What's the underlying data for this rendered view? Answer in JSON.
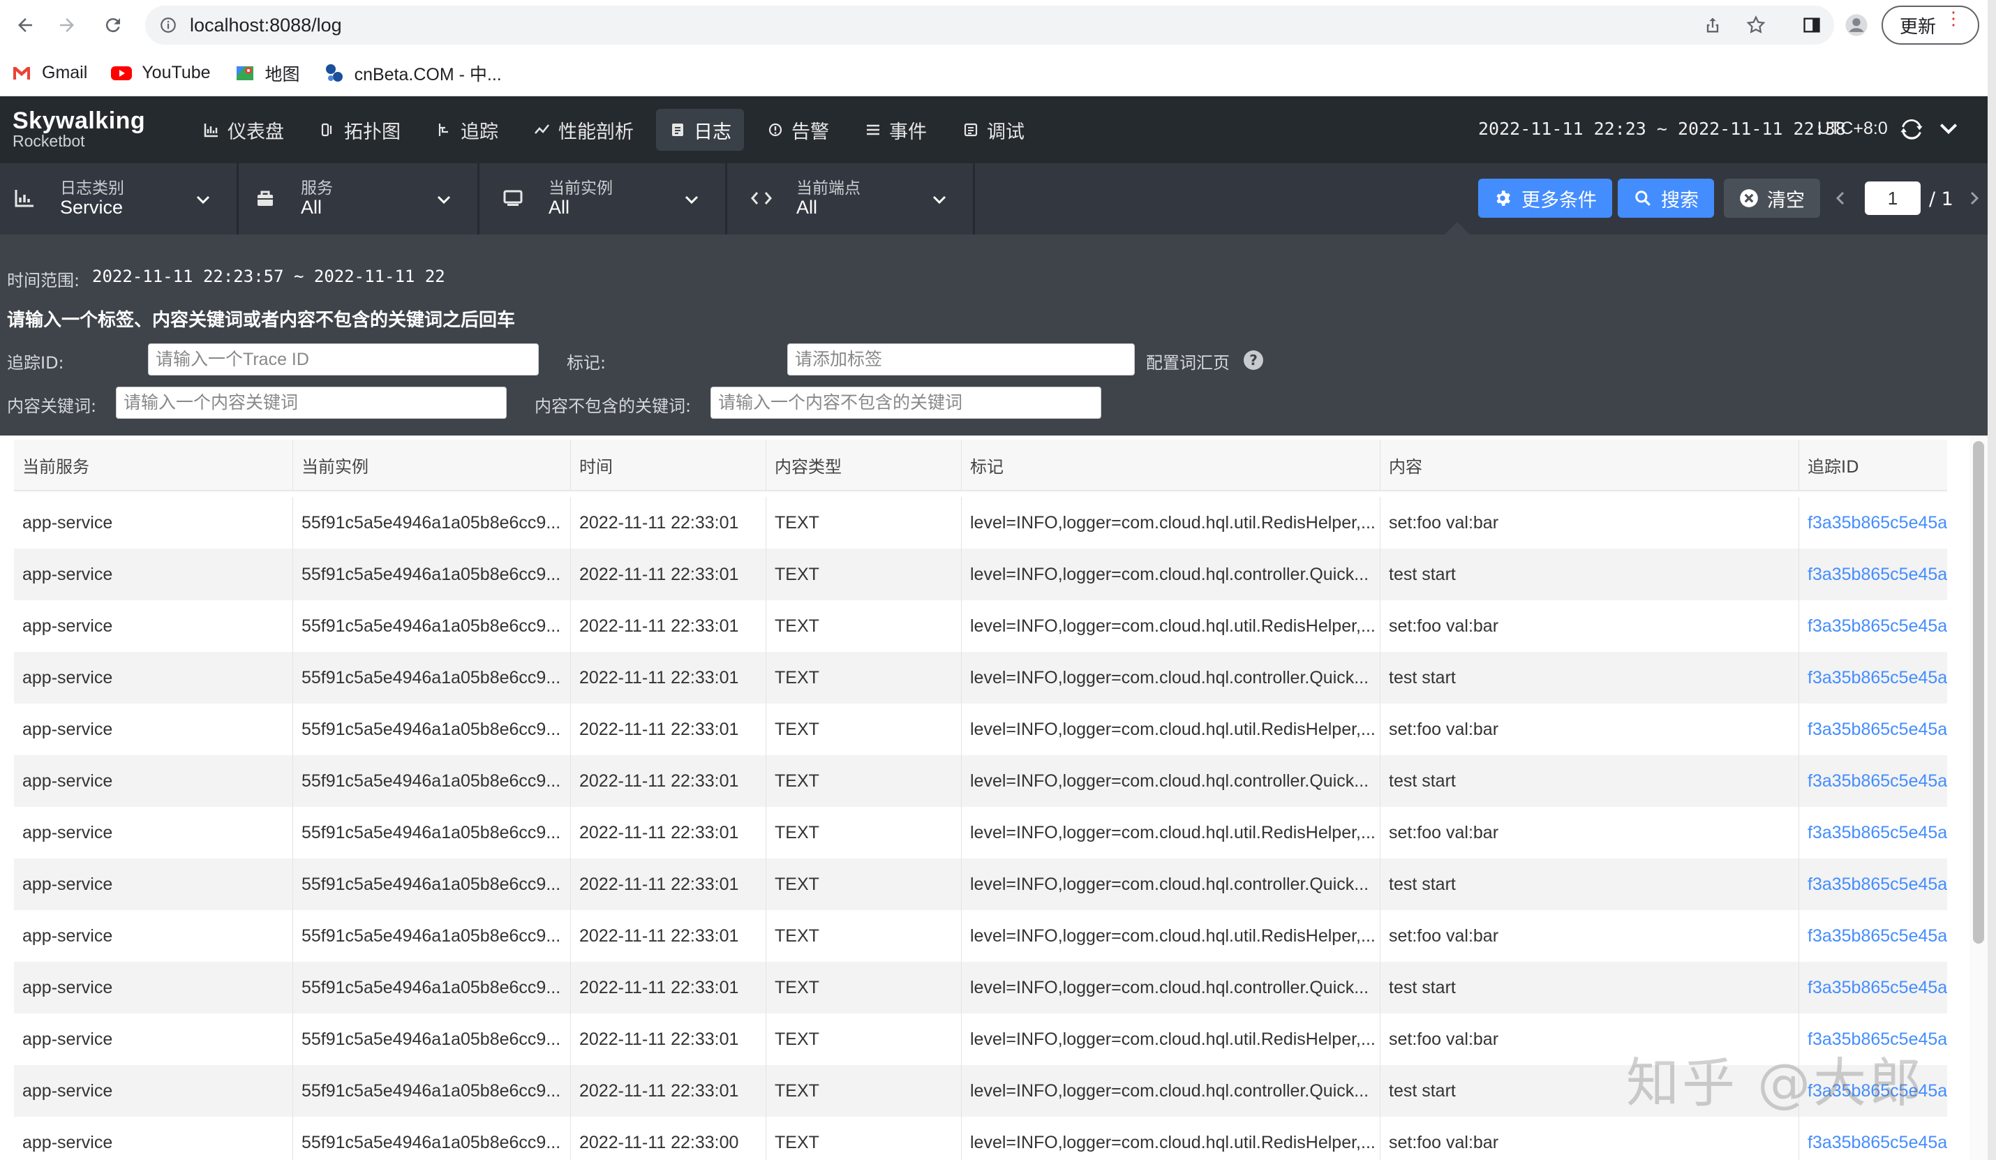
{
  "browser": {
    "url": "localhost:8088/log",
    "update_label": "更新",
    "bookmarks": [
      {
        "label": "Gmail"
      },
      {
        "label": "YouTube"
      },
      {
        "label": "地图"
      },
      {
        "label": "cnBeta.COM - 中..."
      }
    ]
  },
  "app": {
    "brand": "Skywalking",
    "sub_brand": "Rocketbot",
    "nav": [
      {
        "label": "仪表盘",
        "icon": "chart-icon"
      },
      {
        "label": "拓扑图",
        "icon": "topology-icon"
      },
      {
        "label": "追踪",
        "icon": "trace-icon"
      },
      {
        "label": "性能剖析",
        "icon": "profile-icon"
      },
      {
        "label": "日志",
        "icon": "log-icon",
        "active": true
      },
      {
        "label": "告警",
        "icon": "alarm-icon"
      },
      {
        "label": "事件",
        "icon": "event-icon"
      },
      {
        "label": "调试",
        "icon": "debug-icon"
      }
    ],
    "time_range": "2022-11-11 22:23 ~ 2022-11-11 22:38",
    "timezone": "UTC+8:0"
  },
  "filters": {
    "log_type": {
      "label": "日志类别",
      "value": "Service"
    },
    "service": {
      "label": "服务",
      "value": "All"
    },
    "instance": {
      "label": "当前实例",
      "value": "All"
    },
    "endpoint": {
      "label": "当前端点",
      "value": "All"
    },
    "more_conditions": "更多条件",
    "search": "搜索",
    "clear": "清空",
    "page_current": "1",
    "page_total": "/ 1"
  },
  "conditions": {
    "time_label": "时间范围:",
    "time_value": "2022-11-11 22:23:57 ~ 2022-11-11 22",
    "hint": "请输入一个标签、内容关键词或者内容不包含的关键词之后回车",
    "trace_id_label": "追踪ID:",
    "trace_id_placeholder": "请输入一个Trace ID",
    "tags_label": "标记:",
    "tags_placeholder": "请添加标签",
    "config_link": "配置词汇页",
    "keyword_label": "内容关键词:",
    "keyword_placeholder": "请输入一个内容关键词",
    "exclude_label": "内容不包含的关键词:",
    "exclude_placeholder": "请输入一个内容不包含的关键词"
  },
  "table": {
    "columns": [
      "当前服务",
      "当前实例",
      "时间",
      "内容类型",
      "标记",
      "内容",
      "追踪ID"
    ],
    "rows": [
      [
        "app-service",
        "55f91c5a5e4946a1a05b8e6cc9...",
        "2022-11-11 22:33:01",
        "TEXT",
        "level=INFO,logger=com.cloud.hql.util.RedisHelper,...",
        "set:foo val:bar",
        "f3a35b865c5e45a"
      ],
      [
        "app-service",
        "55f91c5a5e4946a1a05b8e6cc9...",
        "2022-11-11 22:33:01",
        "TEXT",
        "level=INFO,logger=com.cloud.hql.controller.Quick...",
        "test start",
        "f3a35b865c5e45a"
      ],
      [
        "app-service",
        "55f91c5a5e4946a1a05b8e6cc9...",
        "2022-11-11 22:33:01",
        "TEXT",
        "level=INFO,logger=com.cloud.hql.util.RedisHelper,...",
        "set:foo val:bar",
        "f3a35b865c5e45a"
      ],
      [
        "app-service",
        "55f91c5a5e4946a1a05b8e6cc9...",
        "2022-11-11 22:33:01",
        "TEXT",
        "level=INFO,logger=com.cloud.hql.controller.Quick...",
        "test start",
        "f3a35b865c5e45a"
      ],
      [
        "app-service",
        "55f91c5a5e4946a1a05b8e6cc9...",
        "2022-11-11 22:33:01",
        "TEXT",
        "level=INFO,logger=com.cloud.hql.util.RedisHelper,...",
        "set:foo val:bar",
        "f3a35b865c5e45a"
      ],
      [
        "app-service",
        "55f91c5a5e4946a1a05b8e6cc9...",
        "2022-11-11 22:33:01",
        "TEXT",
        "level=INFO,logger=com.cloud.hql.controller.Quick...",
        "test start",
        "f3a35b865c5e45a"
      ],
      [
        "app-service",
        "55f91c5a5e4946a1a05b8e6cc9...",
        "2022-11-11 22:33:01",
        "TEXT",
        "level=INFO,logger=com.cloud.hql.util.RedisHelper,...",
        "set:foo val:bar",
        "f3a35b865c5e45a"
      ],
      [
        "app-service",
        "55f91c5a5e4946a1a05b8e6cc9...",
        "2022-11-11 22:33:01",
        "TEXT",
        "level=INFO,logger=com.cloud.hql.controller.Quick...",
        "test start",
        "f3a35b865c5e45a"
      ],
      [
        "app-service",
        "55f91c5a5e4946a1a05b8e6cc9...",
        "2022-11-11 22:33:01",
        "TEXT",
        "level=INFO,logger=com.cloud.hql.util.RedisHelper,...",
        "set:foo val:bar",
        "f3a35b865c5e45a"
      ],
      [
        "app-service",
        "55f91c5a5e4946a1a05b8e6cc9...",
        "2022-11-11 22:33:01",
        "TEXT",
        "level=INFO,logger=com.cloud.hql.controller.Quick...",
        "test start",
        "f3a35b865c5e45a"
      ],
      [
        "app-service",
        "55f91c5a5e4946a1a05b8e6cc9...",
        "2022-11-11 22:33:01",
        "TEXT",
        "level=INFO,logger=com.cloud.hql.util.RedisHelper,...",
        "set:foo val:bar",
        "f3a35b865c5e45a"
      ],
      [
        "app-service",
        "55f91c5a5e4946a1a05b8e6cc9...",
        "2022-11-11 22:33:01",
        "TEXT",
        "level=INFO,logger=com.cloud.hql.controller.Quick...",
        "test start",
        "f3a35b865c5e45a"
      ],
      [
        "app-service",
        "55f91c5a5e4946a1a05b8e6cc9...",
        "2022-11-11 22:33:00",
        "TEXT",
        "level=INFO,logger=com.cloud.hql.util.RedisHelper,...",
        "set:foo val:bar",
        "f3a35b865c5e45a"
      ]
    ]
  },
  "watermark": "知乎 @大郎",
  "colors": {
    "header_bg": "#252a2f",
    "filter_bg": "#333840",
    "panel_bg": "#3f444b",
    "accent": "#448dfe"
  }
}
